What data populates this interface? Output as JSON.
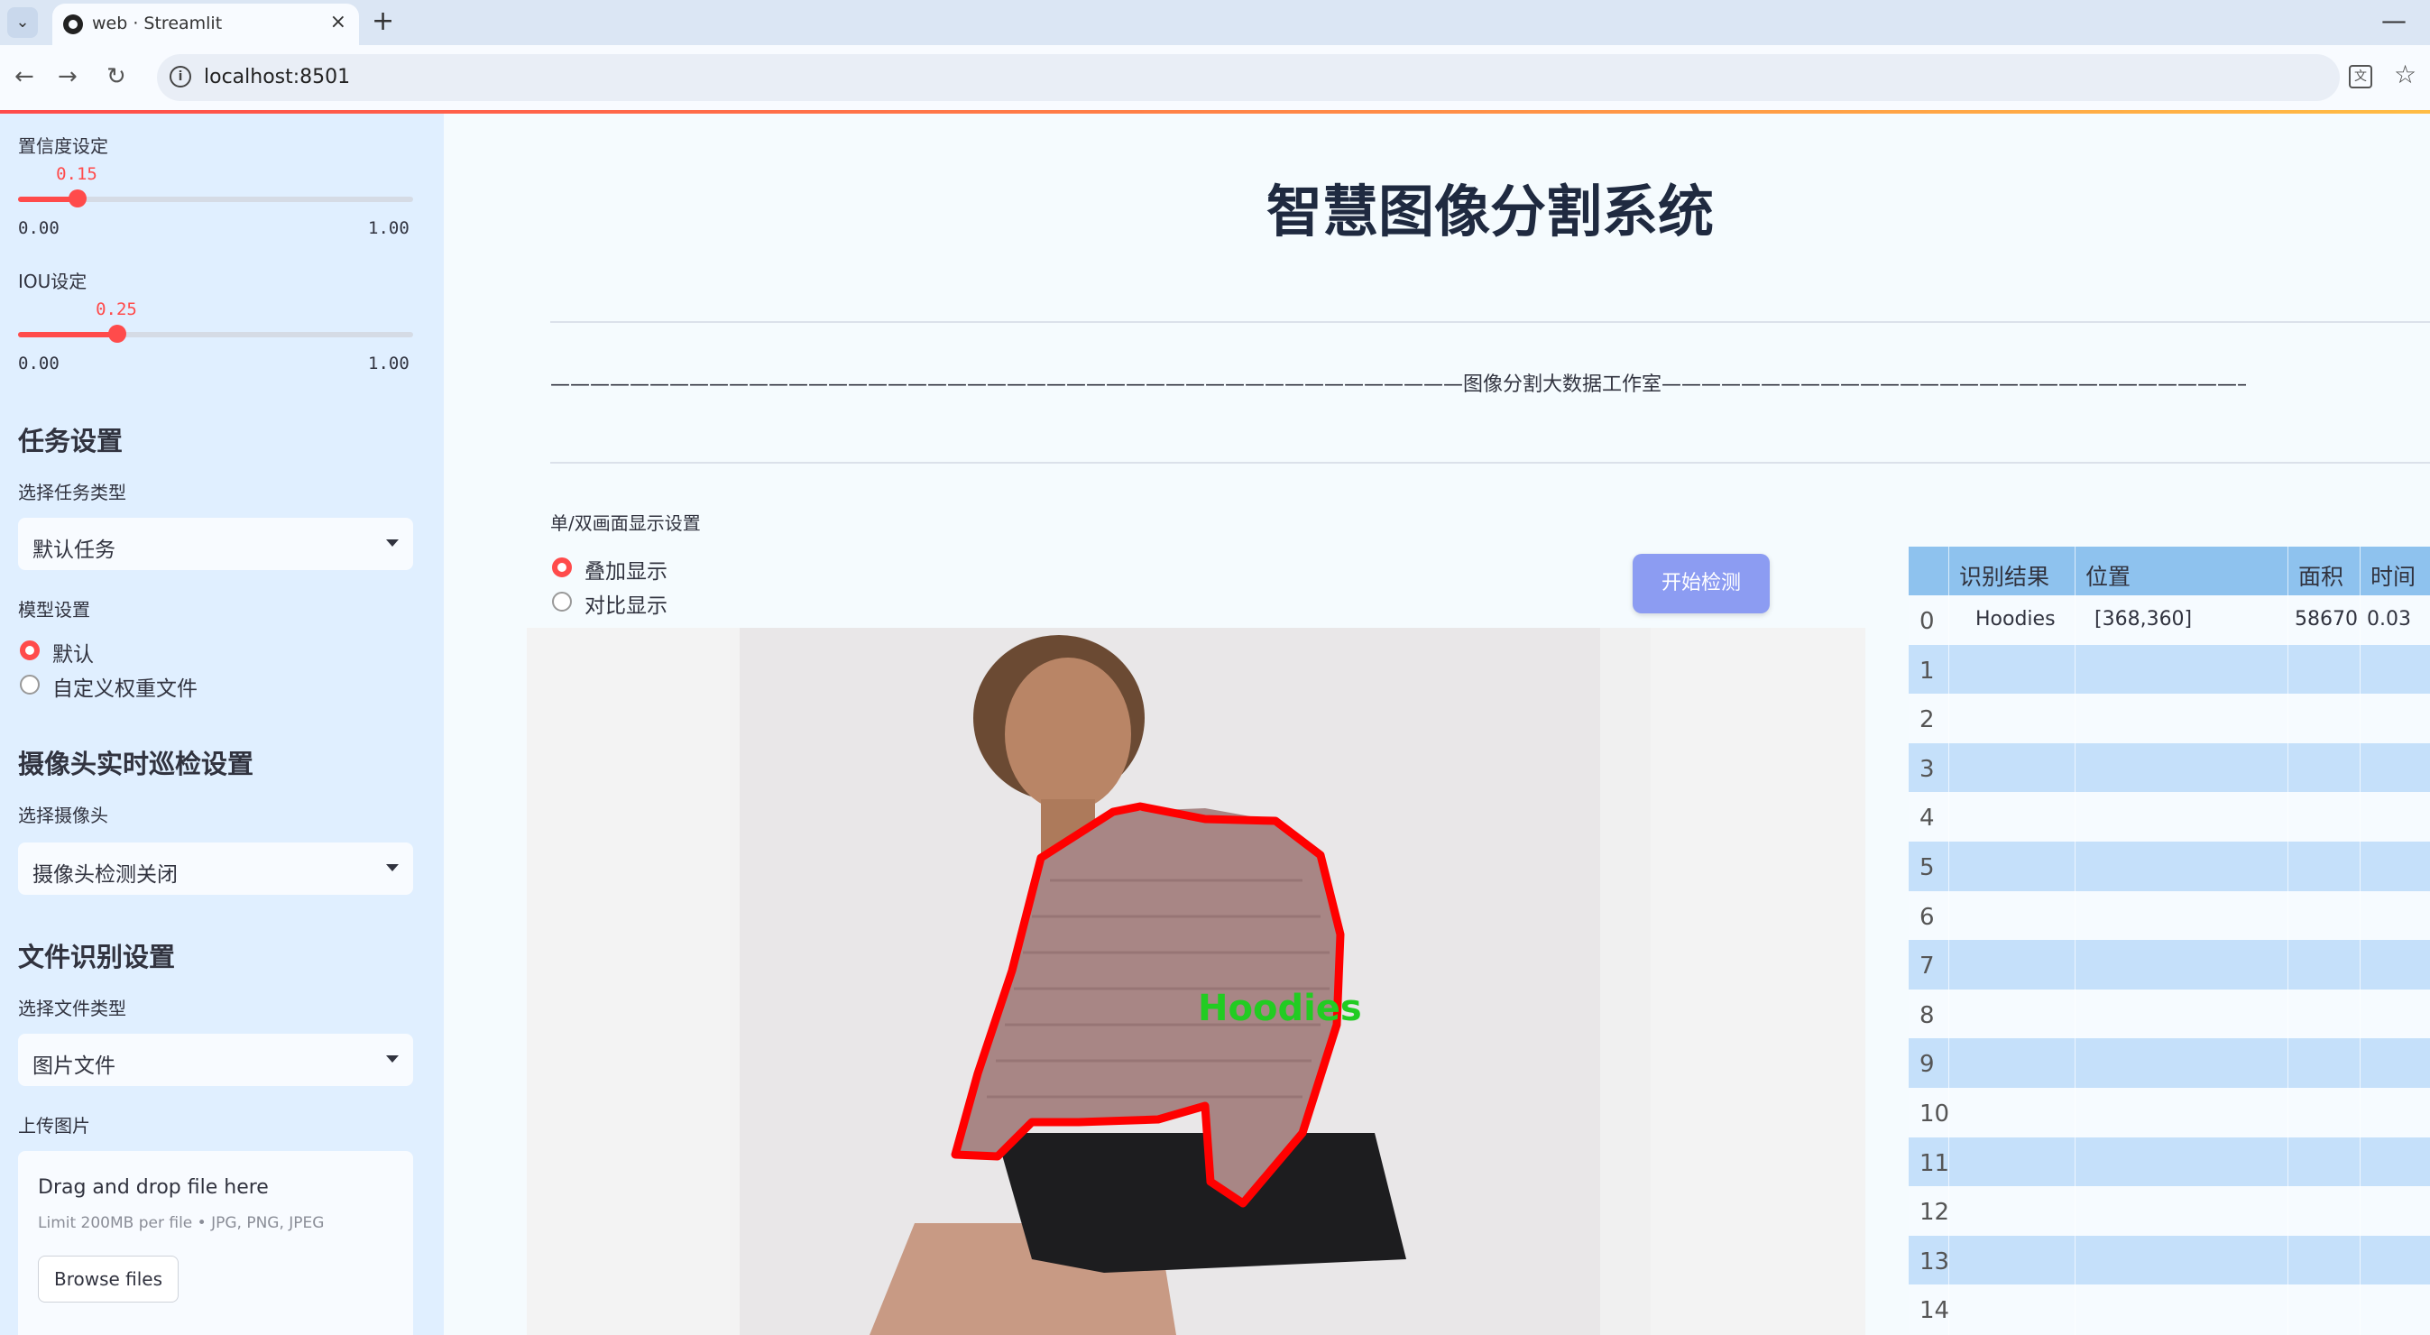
{
  "browser": {
    "tab_title": "web · Streamlit",
    "url": "localhost:8501",
    "new_tab": "+",
    "close": "×",
    "minimize": "—"
  },
  "sidebar": {
    "confidence": {
      "label": "置信度设定",
      "value_text": "0.15",
      "value": 0.15,
      "min": "0.00",
      "max": "1.00"
    },
    "iou": {
      "label": "IOU设定",
      "value_text": "0.25",
      "value": 0.25,
      "min": "0.00",
      "max": "1.00"
    },
    "task_section": {
      "heading": "任务设置",
      "label": "选择任务类型",
      "selected": "默认任务"
    },
    "model_section": {
      "label": "模型设置",
      "options": [
        "默认",
        "自定义权重文件"
      ],
      "selected_index": 0
    },
    "camera_section": {
      "heading": "摄像头实时巡检设置",
      "label": "选择摄像头",
      "selected": "摄像头检测关闭"
    },
    "file_section": {
      "heading": "文件识别设置",
      "label": "选择文件类型",
      "selected": "图片文件"
    },
    "upload": {
      "label": "上传图片",
      "title": "Drag and drop file here",
      "limit": "Limit 200MB per file • JPG, PNG, JPEG",
      "button": "Browse files"
    }
  },
  "main": {
    "title": "智慧图像分割系统",
    "subtitle": "——————————————————————————————————————————————图像分割大数据工作室——————————————————————————————————————————————————",
    "display_label": "单/双画面显示设置",
    "display_options": [
      "叠加显示",
      "对比显示"
    ],
    "display_selected_index": 0,
    "start_button": "开始检测",
    "detection_label": "Hoodies"
  },
  "table": {
    "columns": [
      "识别结果",
      "位置",
      "面积",
      "时间"
    ],
    "rows": [
      {
        "index": "0",
        "result": "Hoodies",
        "position": "[368,360]",
        "area": "58670",
        "time": "0.03"
      },
      {
        "index": "1"
      },
      {
        "index": "2"
      },
      {
        "index": "3"
      },
      {
        "index": "4"
      },
      {
        "index": "5"
      },
      {
        "index": "6"
      },
      {
        "index": "7"
      },
      {
        "index": "8"
      },
      {
        "index": "9"
      },
      {
        "index": "10"
      },
      {
        "index": "11"
      },
      {
        "index": "12"
      },
      {
        "index": "13"
      },
      {
        "index": "14"
      }
    ]
  },
  "colors": {
    "accent": "#ff4b4b",
    "sidebar_bg": "#e0efff",
    "button": "#8c9cf2",
    "table_header": "#8ec2ee",
    "table_stripe": "#c5e0fa",
    "mask_outline": "#ff0000",
    "mask_label": "#22cc22"
  }
}
